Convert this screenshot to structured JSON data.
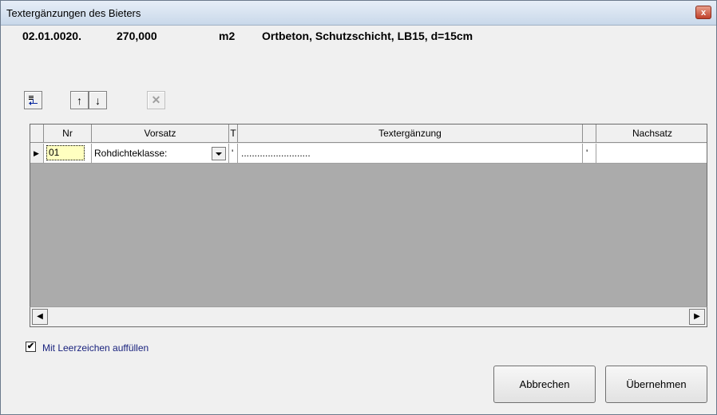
{
  "window": {
    "title": "Textergänzungen des Bieters",
    "close_glyph": "x"
  },
  "position": {
    "number": "02.01.0020.",
    "quantity": "270,000",
    "unit": "m2",
    "description": "Ortbeton, Schutzschicht, LB15, d=15cm"
  },
  "toolbar": {
    "insert_icon": "insert-row-icon",
    "up_label": "↑",
    "down_label": "↓",
    "delete_label": "✕"
  },
  "grid": {
    "columns": [
      "Nr",
      "Vorsatz",
      "T",
      "Textergänzung",
      "",
      "Nachsatz"
    ],
    "rows": [
      {
        "nr": "01",
        "vorsatz": "Rohdichteklasse:",
        "t": "'",
        "textergaenzung": "..........................",
        "sep": "'",
        "nachsatz": ""
      }
    ]
  },
  "fill_with_spaces": {
    "label": "Mit Leerzeichen auffüllen",
    "checked": true,
    "check_glyph": "✔"
  },
  "buttons": {
    "cancel": "Abbrechen",
    "apply": "Übernehmen"
  },
  "scroll": {
    "left_glyph": "◀",
    "right_glyph": "▶"
  }
}
